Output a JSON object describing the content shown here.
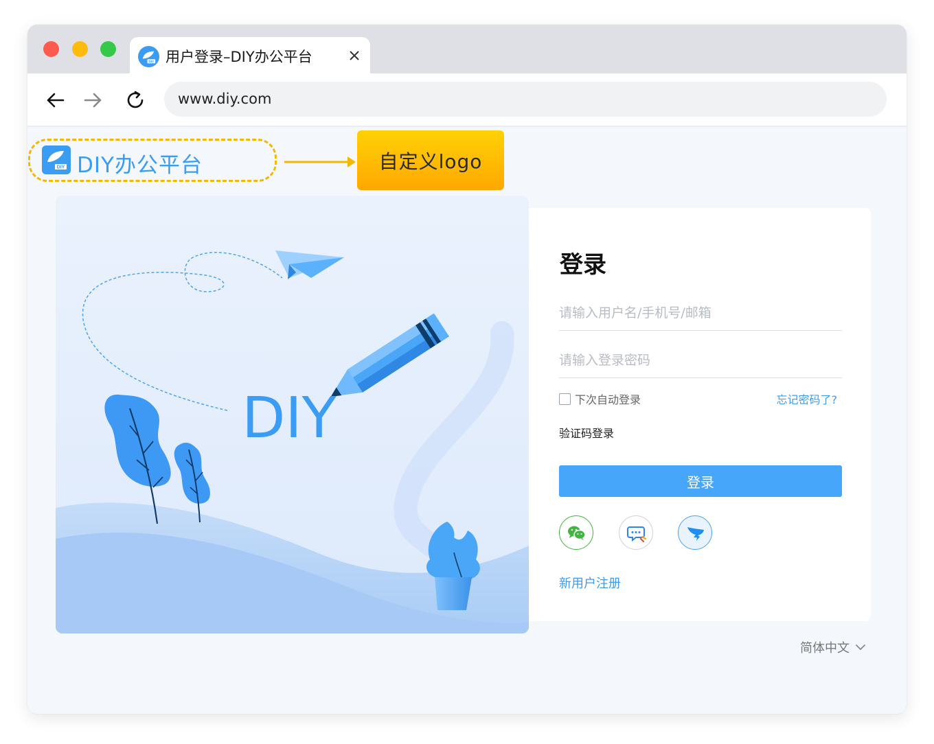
{
  "browser": {
    "tab_title": "用户登录–DIY办公平台",
    "url": "www.diy.com"
  },
  "branding": {
    "logo_text": "DIY办公平台",
    "callout_text": "自定义logo",
    "illustration_text": "DIY"
  },
  "login": {
    "title": "登录",
    "username_placeholder": "请输入用户名/手机号/邮箱",
    "password_placeholder": "请输入登录密码",
    "remember_label": "下次自动登录",
    "forgot_link": "忘记密码了?",
    "code_login_link": "验证码登录",
    "submit_label": "登录",
    "social": [
      "wechat-icon",
      "chat-icon",
      "dingtalk-icon"
    ],
    "register_link": "新用户注册"
  },
  "language": {
    "current": "简体中文"
  },
  "colors": {
    "accent": "#45a6fa",
    "link": "#3f9be8",
    "callout": "#ffb800",
    "wechat": "#3fb63f"
  }
}
